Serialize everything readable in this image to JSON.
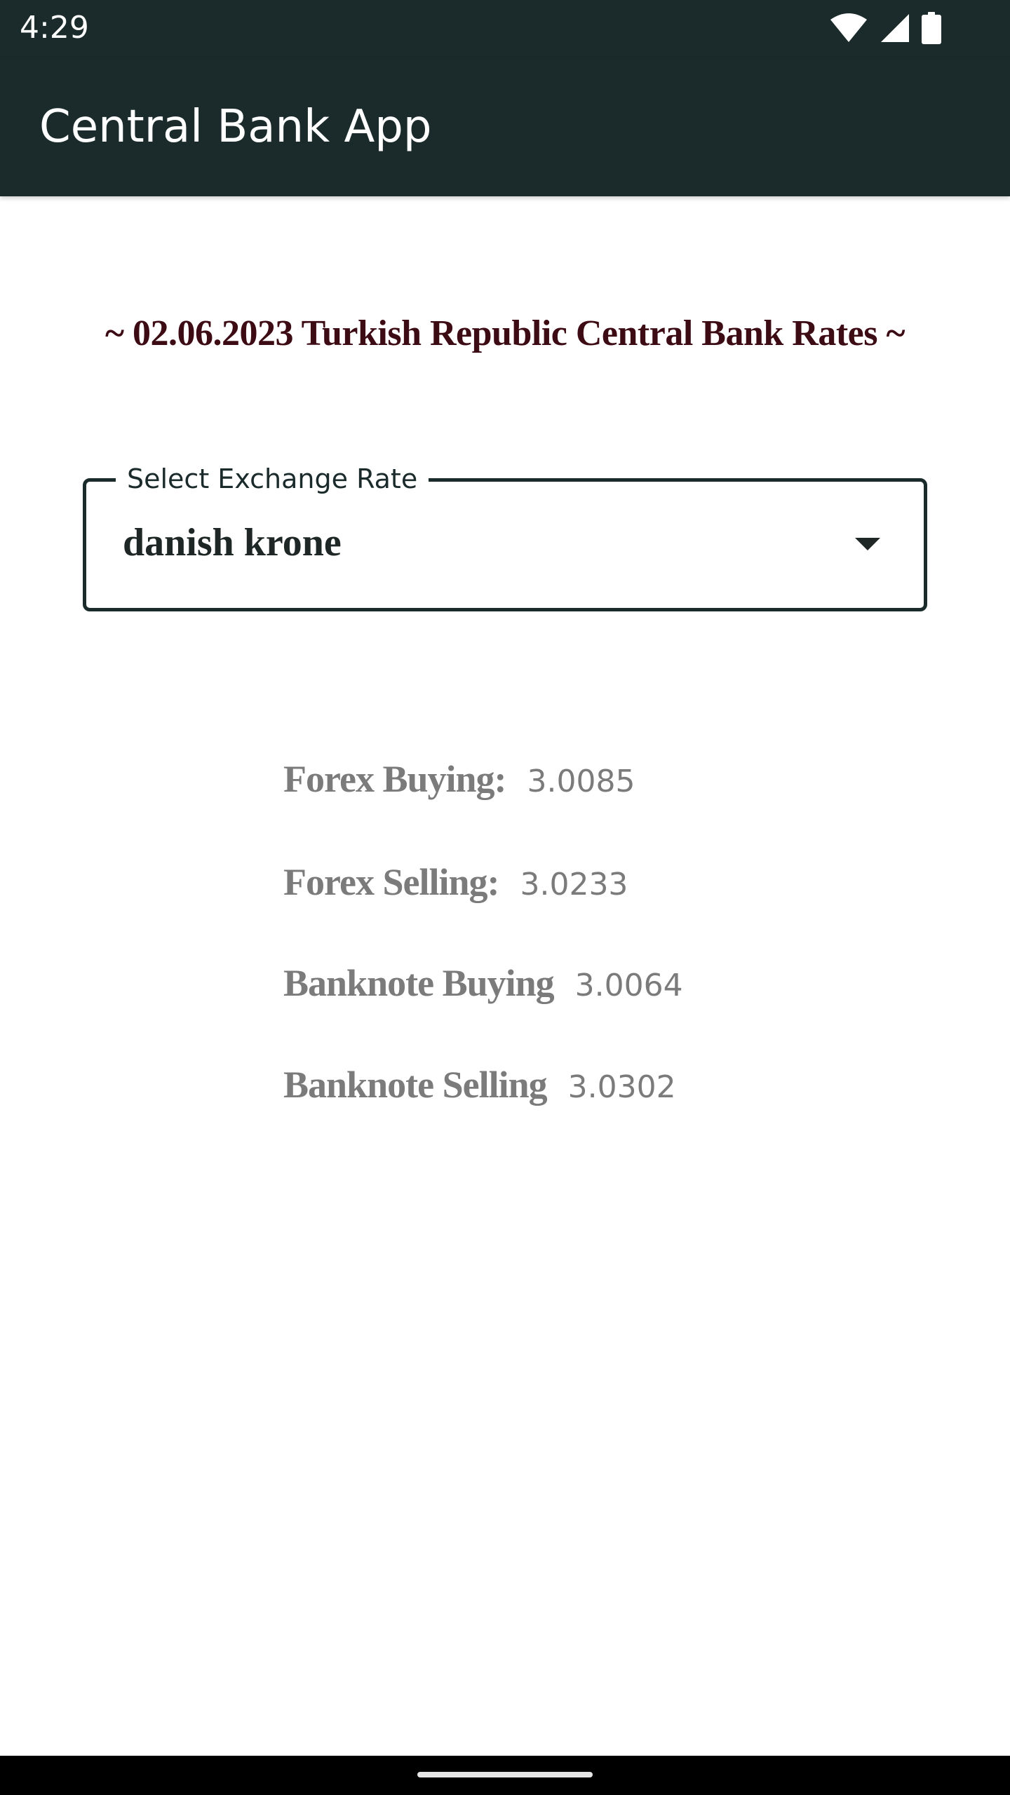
{
  "status_bar": {
    "time": "4:29",
    "icons": [
      "wifi-icon",
      "cellular-signal-icon",
      "battery-icon"
    ]
  },
  "app_bar": {
    "title": "Central Bank App"
  },
  "heading": {
    "text": "~ 02.06.2023 Turkish Republic Central Bank Rates ~"
  },
  "exchange_select": {
    "label": "Select Exchange Rate",
    "value": "danish krone"
  },
  "rates": {
    "forex_buying": {
      "label": "Forex Buying:",
      "value": "3.0085"
    },
    "forex_selling": {
      "label": "Forex Selling:",
      "value": "3.0233"
    },
    "banknote_buying": {
      "label": "Banknote Buying",
      "value": "3.0064"
    },
    "banknote_selling": {
      "label": "Banknote Selling",
      "value": "3.0302"
    }
  },
  "colors": {
    "app_bar_background": "#1b2b2b",
    "heading_text": "#3d0b14",
    "rate_text": "#7b7b7b"
  }
}
